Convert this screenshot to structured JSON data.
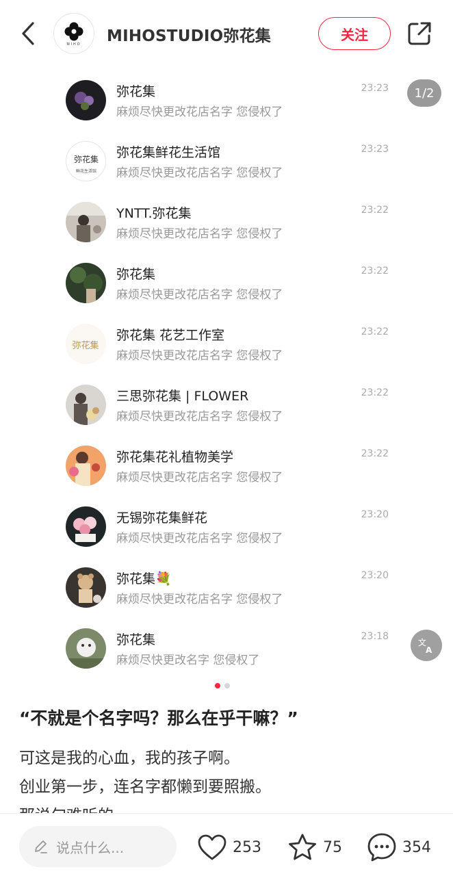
{
  "header": {
    "profile_name": "MIHOSTUDIO弥花集",
    "avatar_text": "MIHO",
    "follow_label": "关注"
  },
  "carousel": {
    "page_indicator": "1/2",
    "current_page": 1,
    "total_pages": 2
  },
  "messages": [
    {
      "name": "弥花集",
      "preview": "麻烦尽快更改花店名字 您侵权了",
      "time": "23:23"
    },
    {
      "name": "弥花集鲜花生活馆",
      "preview": "麻烦尽快更改花店名字 您侵权了",
      "time": "23:23",
      "avatar_text": "弥花集",
      "avatar_subtext": "鲜花生活馆"
    },
    {
      "name": "YNTT.弥花集",
      "preview": "麻烦尽快更改花店名字 您侵权了",
      "time": "23:22"
    },
    {
      "name": "弥花集",
      "preview": "麻烦尽快更改花店名字 您侵权了",
      "time": "23:22"
    },
    {
      "name": "弥花集 花艺工作室",
      "preview": "麻烦尽快更改花店名字 您侵权了",
      "time": "23:22",
      "avatar_text": "弥花集"
    },
    {
      "name": "三思弥花集 | FLOWER",
      "preview": "麻烦尽快更改花店名字 您侵权了",
      "time": "23:22"
    },
    {
      "name": "弥花集花礼植物美学",
      "preview": "麻烦尽快更改花店名字 您侵权了",
      "time": "23:22"
    },
    {
      "name": "无锡弥花集鲜花",
      "preview": "麻烦尽快更改花店名字 您侵权了",
      "time": "23:20"
    },
    {
      "name": "弥花集💐",
      "preview": "麻烦尽快更改花店名字 您侵权了",
      "time": "23:20"
    },
    {
      "name": "弥花集",
      "preview": "麻烦尽快更改名字 您侵权了",
      "time": "23:18"
    }
  ],
  "post": {
    "title": "“不就是个名字吗？那么在乎干嘛？”",
    "lines": [
      "可这是我的心血，我的孩子啊。",
      "创业第一步，连名字都懒到要照搬。",
      "那说句难听的"
    ]
  },
  "bottom_bar": {
    "comment_placeholder": "说点什么...",
    "likes": "253",
    "collects": "75",
    "comments": "354"
  },
  "colors": {
    "accent": "#ff2442",
    "muted_text": "#999999"
  },
  "icons": [
    "back-icon",
    "share-icon",
    "translate-icon",
    "pencil-icon",
    "heart-icon",
    "star-icon",
    "comment-icon"
  ]
}
